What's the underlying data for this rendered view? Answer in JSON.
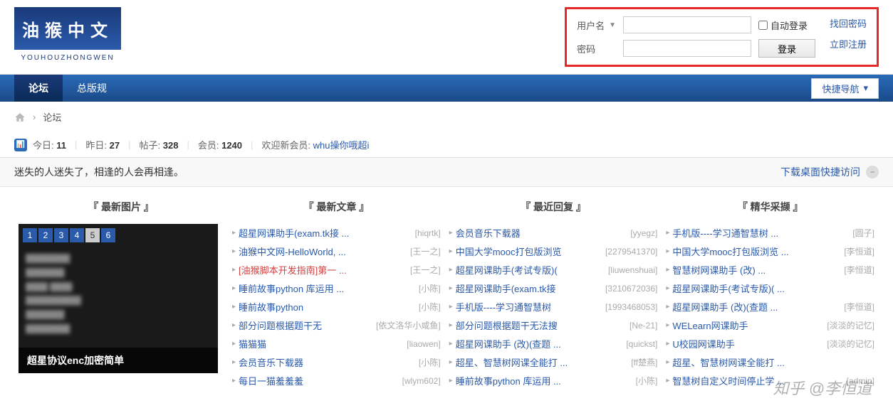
{
  "logo": {
    "text": "油猴中文",
    "sub": "YOUHOUZHONGWEN"
  },
  "login": {
    "username_label": "用户名",
    "password_label": "密码",
    "auto_label": "自动登录",
    "login_btn": "登录",
    "forgot": "找回密码",
    "register": "立即注册"
  },
  "nav": {
    "forum": "论坛",
    "rules": "总版规",
    "quick": "快捷导航"
  },
  "breadcrumb": {
    "forum": "论坛"
  },
  "stats": {
    "today_label": "今日:",
    "today_val": "11",
    "yesterday_label": "昨日:",
    "yesterday_val": "27",
    "posts_label": "帖子:",
    "posts_val": "328",
    "members_label": "会员:",
    "members_val": "1240",
    "welcome_label": "欢迎新会员:",
    "newuser": "whu操你哦超i"
  },
  "quote": {
    "text": "迷失的人迷失了，相逢的人会再相逢。",
    "download": "下载桌面快捷访问"
  },
  "cols": {
    "images": "『 最新图片 』",
    "articles": "『 最新文章 』",
    "replies": "『 最近回复 』",
    "featured": "『 精华采撷 』"
  },
  "img_preview": {
    "pages": [
      "1",
      "2",
      "3",
      "4",
      "5",
      "6"
    ],
    "active_page": "5",
    "caption": "超星协议enc加密简单"
  },
  "articles": [
    {
      "t": "超星网课助手(exam.tk接 ...",
      "a": "[hiqrtk]"
    },
    {
      "t": "油猴中文网-HelloWorld, ...",
      "a": "[王一之]"
    },
    {
      "t": "[油猴脚本开发指南]第一 ...",
      "a": "[王一之]",
      "hot": true
    },
    {
      "t": "睡前故事python 库运用 ...",
      "a": "[小陈]"
    },
    {
      "t": "睡前故事python",
      "a": "[小陈]"
    },
    {
      "t": "部分问题根据题干无",
      "a": "[依文洛华小咸鱼]"
    },
    {
      "t": "猫猫猫",
      "a": "[liaowen]"
    },
    {
      "t": "会员音乐下载器",
      "a": "[小陈]"
    },
    {
      "t": "每日一猫羞羞羞",
      "a": "[wlym602]"
    }
  ],
  "replies": [
    {
      "t": "会员音乐下载器",
      "a": "[yyegz]"
    },
    {
      "t": "中国大学mooc打包版浏览",
      "a": "[2279541370]"
    },
    {
      "t": "超星网课助手(考试专版)(",
      "a": "[liuwenshuai]"
    },
    {
      "t": "超星网课助手(exam.tk接",
      "a": "[3210672036]"
    },
    {
      "t": "手机版----学习通智慧树",
      "a": "[1993468053]"
    },
    {
      "t": "部分问题根据题干无法搜",
      "a": "[Ne-21]"
    },
    {
      "t": "超星网课助手 (改)(查题 ...",
      "a": "[quickst]"
    },
    {
      "t": "超星、智慧树网课全能打 ...",
      "a": "[ff楚燕]"
    },
    {
      "t": "睡前故事python 库运用 ...",
      "a": "[小陈]"
    }
  ],
  "featured": [
    {
      "t": "手机版----学习通智慧树 ...",
      "a": "[圆子]"
    },
    {
      "t": "中国大学mooc打包版浏览 ...",
      "a": "[李恒道]"
    },
    {
      "t": "智慧树网课助手 (改) ...",
      "a": "[李恒道]"
    },
    {
      "t": "超星网课助手(考试专版)( ...",
      "a": ""
    },
    {
      "t": "超星网课助手 (改)(查题 ...",
      "a": "[李恒道]"
    },
    {
      "t": "WELearn网课助手",
      "a": "[淡淡的记忆]"
    },
    {
      "t": "U校园网课助手",
      "a": "[淡淡的记忆]"
    },
    {
      "t": "超星、智慧树网课全能打 ...",
      "a": ""
    },
    {
      "t": "智慧树自定义时间停止学 ...",
      "a": "[admin]"
    }
  ],
  "watermark": "知乎 @李恒道"
}
